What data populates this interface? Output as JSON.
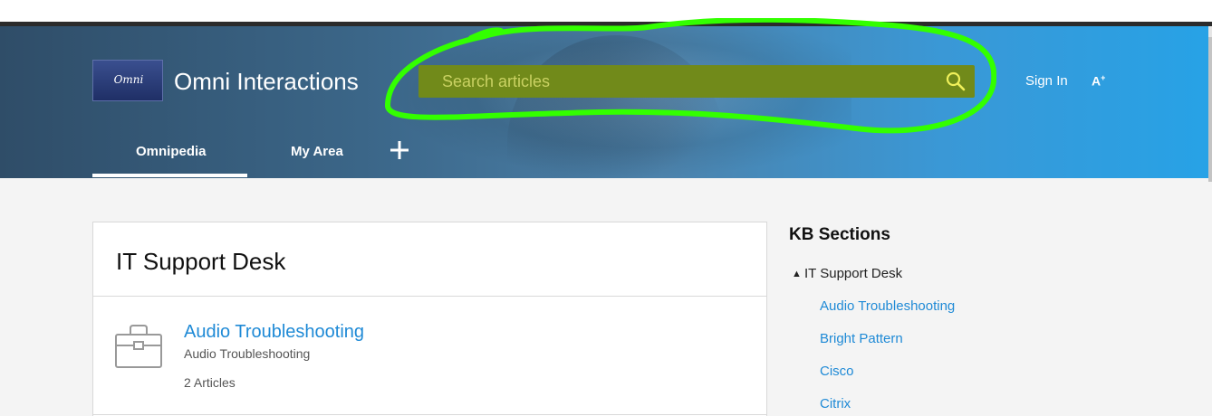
{
  "header": {
    "logo_text": "Omni",
    "site_title": "Omni Interactions",
    "search_placeholder": "Search articles",
    "sign_in": "Sign In",
    "a11y_label": "A+",
    "tabs": [
      {
        "label": "Omnipedia",
        "active": true
      },
      {
        "label": "My Area",
        "active": false
      }
    ],
    "add_tab_icon": "plus-icon",
    "search_icon": "search-icon"
  },
  "main": {
    "panel_title": "IT Support Desk",
    "items": [
      {
        "title": "Audio Troubleshooting",
        "description": "Audio Troubleshooting",
        "count": "2 Articles",
        "icon": "briefcase-icon"
      }
    ]
  },
  "sidebar": {
    "heading": "KB Sections",
    "parent": "IT Support Desk",
    "caret_icon": "caret-up-icon",
    "links": [
      "Audio Troubleshooting",
      "Bright Pattern",
      "Cisco",
      "Citrix"
    ]
  },
  "colors": {
    "link": "#1f8ad6",
    "search_highlight": "#718a1a",
    "annotation_stroke": "#33ff00",
    "header_dark": "#2f4d68",
    "header_light": "#27a2e6"
  }
}
